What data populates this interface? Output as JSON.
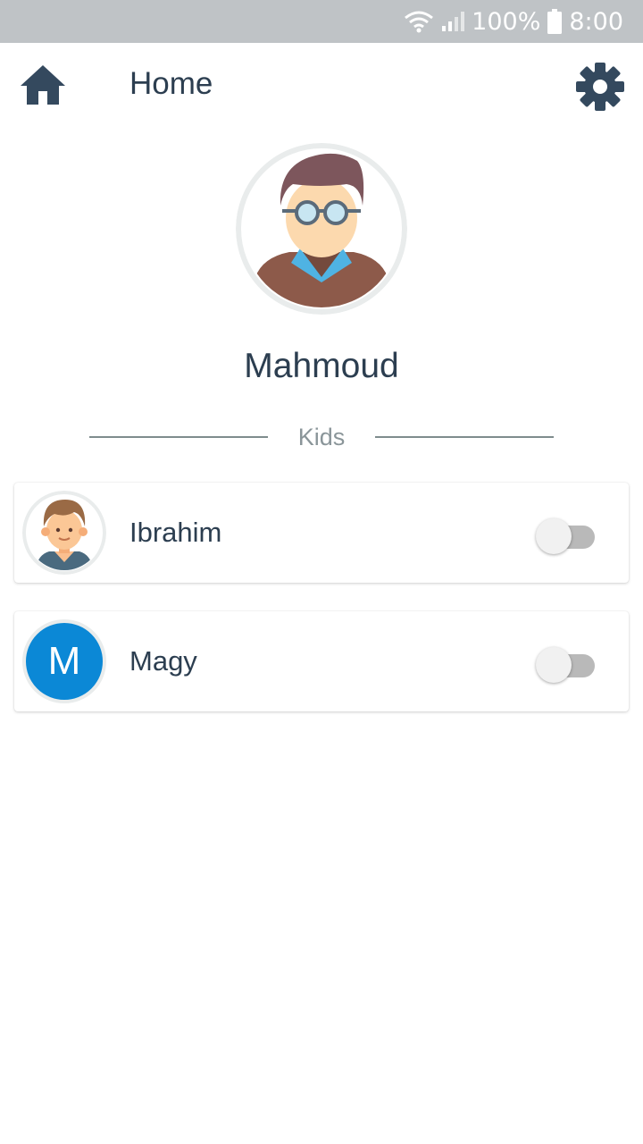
{
  "status_bar": {
    "battery": "100%",
    "time": "8:00",
    "icons": [
      "wifi-icon",
      "signal-icon",
      "battery-icon"
    ]
  },
  "header": {
    "title": "Home",
    "home_icon": "home-icon",
    "settings_icon": "gear-icon"
  },
  "profile": {
    "name": "Mahmoud",
    "avatar_icon": "man-with-glasses-avatar"
  },
  "kids_section": {
    "label": "Kids"
  },
  "kids": [
    {
      "name": "Ibrahim",
      "avatar_type": "illustration",
      "avatar_icon": "boy-avatar",
      "enabled": false
    },
    {
      "name": "Magy",
      "avatar_type": "letter",
      "avatar_letter": "M",
      "avatar_color": "#0b88d6",
      "enabled": false
    }
  ],
  "colors": {
    "primary_text": "#2c3e50",
    "icon": "#34495e",
    "status_bar": "#bfc3c6",
    "divider": "#7f8c8d"
  }
}
